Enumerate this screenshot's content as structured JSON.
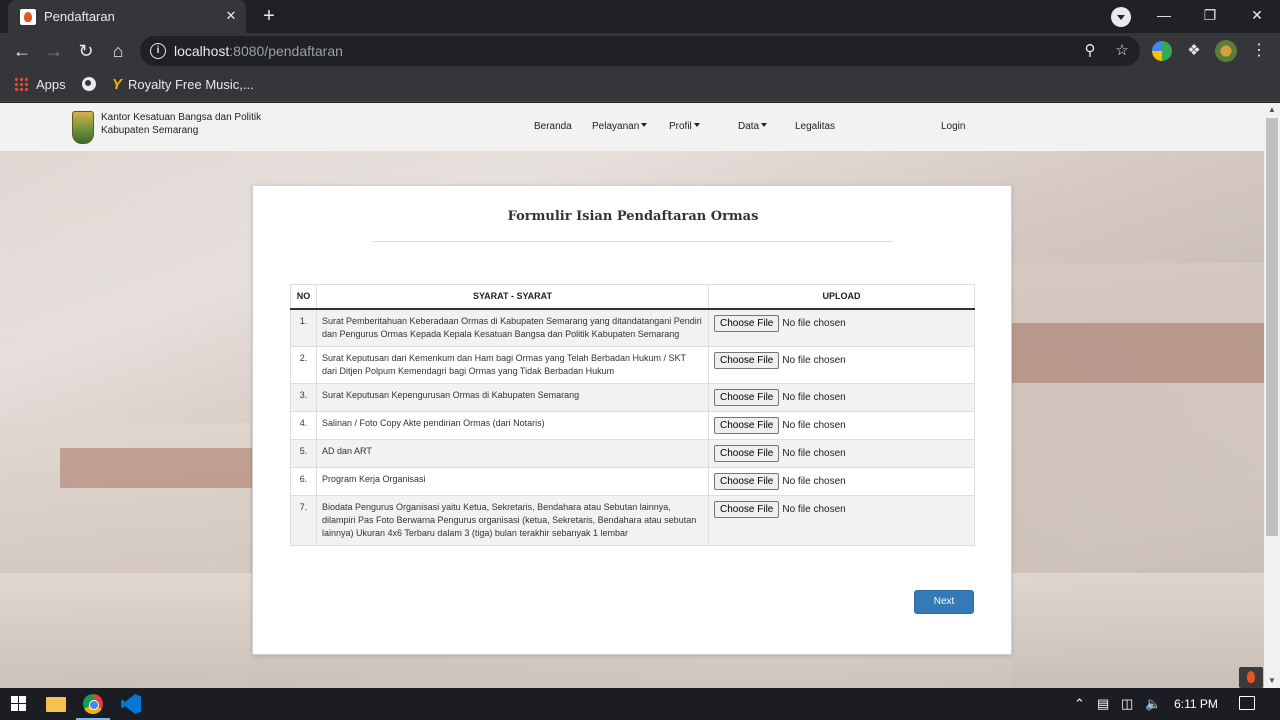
{
  "browser": {
    "tab_title": "Pendaftaran",
    "new_tab": "+",
    "close_tab": "✕",
    "url_host": "localhost",
    "url_path": ":8080/pendaftaran",
    "bookmarks": {
      "apps": "Apps",
      "royalty": "Royalty Free Music,..."
    },
    "window_controls": {
      "minimize": "—",
      "restore": "❐",
      "close": "✕"
    }
  },
  "site": {
    "brand_line1": "Kantor Kesatuan Bangsa dan Politik",
    "brand_line2": "Kabupaten Semarang",
    "nav": {
      "beranda": "Beranda",
      "pelayanan": "Pelayanan",
      "profil": "Profil",
      "data": "Data",
      "legalitas": "Legalitas",
      "login": "Login"
    }
  },
  "form": {
    "title": "Formulir Isian Pendaftaran Ormas",
    "headers": {
      "no": "NO",
      "syarat": "SYARAT - SYARAT",
      "upload": "UPLOAD"
    },
    "choose_label": "Choose File",
    "no_file_label": "No file chosen",
    "rows": [
      {
        "no": "1.",
        "text": "Surat Pemberitahuan Keberadaan Ormas di Kabupaten Semarang yang ditandatangani Pendiri dan Pengurus Ormas Kepada Kepala Kesatuan Bangsa dan Politik Kabupaten Semarang"
      },
      {
        "no": "2.",
        "text": "Surat Keputusan dari Kemenkum dan Ham bagi Ormas yang Telah Berbadan Hukum / SKT dari Ditjen Polpum Kemendagri bagi Ormas yang Tidak Berbadan Hukum"
      },
      {
        "no": "3.",
        "text": "Surat Keputusan Kepengurusan Ormas di Kabupaten Semarang"
      },
      {
        "no": "4.",
        "text": "Salinan / Foto Copy Akte pendirian Ormas (dari Notaris)"
      },
      {
        "no": "5.",
        "text": "AD dan ART"
      },
      {
        "no": "6.",
        "text": "Program Kerja Organisasi"
      },
      {
        "no": "7.",
        "text": "Biodata Pengurus Organisasi yaitu Ketua, Sekretaris, Bendahara atau Sebutan lainnya, dilampiri Pas Foto Berwarna Pengurus organisasi (ketua, Sekretaris, Bendahara atau sebutan lainnya) Ukuran 4x6 Terbaru dalam 3 (tiga) bulan terakhir sebanyak 1 lembar"
      }
    ],
    "next_label": "Next"
  },
  "taskbar": {
    "time": "6:11 PM"
  },
  "colors": {
    "accent_button": "#337ab7",
    "browser_dark": "#202124",
    "browser_toolbar": "#35363a"
  }
}
